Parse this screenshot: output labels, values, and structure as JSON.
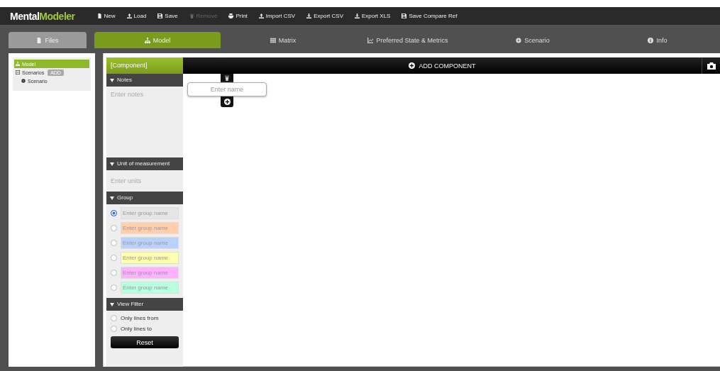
{
  "app": {
    "logo_first": "Mental",
    "logo_second": "Modeler"
  },
  "toolbar": [
    {
      "label": "New",
      "kind": "doc",
      "disabled": false
    },
    {
      "label": "Load",
      "kind": "upload",
      "disabled": false
    },
    {
      "label": "Save",
      "kind": "save",
      "disabled": false
    },
    {
      "label": "Remove",
      "kind": "trash",
      "disabled": true
    },
    {
      "label": "Print",
      "kind": "print",
      "disabled": false
    },
    {
      "label": "Import CSV",
      "kind": "upload",
      "disabled": false
    },
    {
      "label": "Export CSV",
      "kind": "download",
      "disabled": false
    },
    {
      "label": "Export XLS",
      "kind": "download",
      "disabled": false
    },
    {
      "label": "Save Compare Ref",
      "kind": "save",
      "disabled": false
    }
  ],
  "files_tab": {
    "label": "Files"
  },
  "tabs": [
    {
      "label": "Model",
      "kind": "model",
      "selected": true
    },
    {
      "label": "Matrix",
      "kind": "matrix",
      "selected": false
    },
    {
      "label": "Preferred State & Metrics",
      "kind": "chart",
      "selected": false
    },
    {
      "label": "Scenario",
      "kind": "scenario",
      "selected": false
    },
    {
      "label": "Info",
      "kind": "info",
      "selected": false
    }
  ],
  "tree": [
    {
      "label": "Model",
      "kind": "model",
      "selected": true
    },
    {
      "label": "Scenarios",
      "selected": false,
      "badge": "ADD",
      "expanded": true,
      "children": [
        {
          "label": "Scenario",
          "kind": "scenario",
          "selected": false
        }
      ]
    }
  ],
  "component": {
    "title": "[Component]",
    "notes": {
      "header": "Notes",
      "placeholder": "Enter notes"
    },
    "units": {
      "header": "Unit of measurement",
      "placeholder": "Enter units"
    },
    "group": {
      "header": "Group",
      "items": [
        {
          "placeholder": "Enter group name",
          "color": "#e6e6e6",
          "selected": true
        },
        {
          "placeholder": "Enter group name",
          "color": "#ffd0b0",
          "selected": false
        },
        {
          "placeholder": "Enter group name",
          "color": "#b8d2ff",
          "selected": false
        },
        {
          "placeholder": "Enter group name",
          "color": "#ffffb0",
          "selected": false
        },
        {
          "placeholder": "Enter group name",
          "color": "#ffb0ff",
          "selected": false
        },
        {
          "placeholder": "Enter group name",
          "color": "#b8ffe0",
          "selected": false
        }
      ]
    },
    "view_filter": {
      "header": "View Filter",
      "options": [
        {
          "label": "Only lines from",
          "selected": false
        },
        {
          "label": "Only lines to",
          "selected": false
        }
      ],
      "reset": "Reset"
    }
  },
  "canvas": {
    "add_button": "ADD COMPONENT",
    "node": {
      "placeholder": "Enter name"
    }
  }
}
